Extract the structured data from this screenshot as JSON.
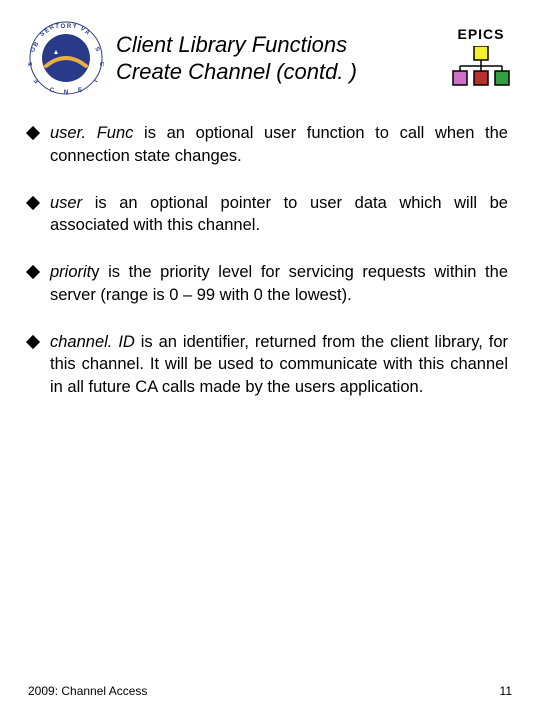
{
  "header": {
    "title_line1": "Client Library Functions",
    "title_line2": "Create Channel (contd. )",
    "epics_label": "EPICS",
    "logo_alt": "Observatory Sciences"
  },
  "epics_colors": {
    "box1": "#f3f030",
    "box2": "#d070c8",
    "box3": "#b83030",
    "box4": "#30a040"
  },
  "bullets": [
    {
      "term": "user. Func",
      "rest": " is an optional user function to call when the connection state changes."
    },
    {
      "term": "user",
      "rest": " is an optional pointer to user data which will be associated with this channel."
    },
    {
      "term": "priorit",
      "term_tail": "y",
      "rest": " is the priority level for servicing requests within the server (range is 0 – 99 with 0 the lowest)."
    },
    {
      "term": "channel. ID",
      "rest": " is an identifier, returned from the client library, for this channel. It will be used to communicate with this channel in all future CA calls made by the users application."
    }
  ],
  "footer": {
    "left": "2009: Channel Access",
    "right": "11"
  }
}
